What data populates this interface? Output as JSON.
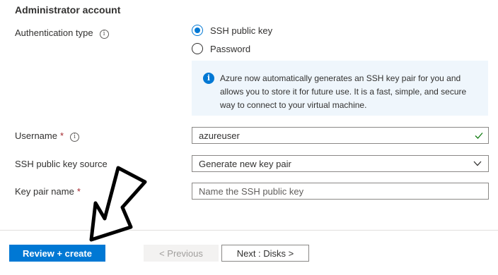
{
  "section": {
    "title": "Administrator account"
  },
  "auth": {
    "label": "Authentication type",
    "options": [
      {
        "label": "SSH public key",
        "selected": true
      },
      {
        "label": "Password",
        "selected": false
      }
    ],
    "info_text": "Azure now automatically generates an SSH key pair for you and allows you to store it for future use. It is a fast, simple, and secure way to connect to your virtual machine."
  },
  "username": {
    "label": "Username",
    "required_mark": "*",
    "value": "azureuser",
    "valid": true
  },
  "ssh_source": {
    "label": "SSH public key source",
    "selected": "Generate new key pair"
  },
  "key_pair_name": {
    "label": "Key pair name",
    "required_mark": "*",
    "value": "",
    "placeholder": "Name the SSH public key"
  },
  "footer": {
    "review_create": "Review + create",
    "previous": "< Previous",
    "next": "Next : Disks >"
  },
  "colors": {
    "accent": "#0078d4",
    "success": "#107c10",
    "required": "#a4262c",
    "info_bg": "#eff6fc"
  },
  "icons": [
    "info-icon",
    "check-icon",
    "chevron-down-icon",
    "annotation-arrow"
  ]
}
